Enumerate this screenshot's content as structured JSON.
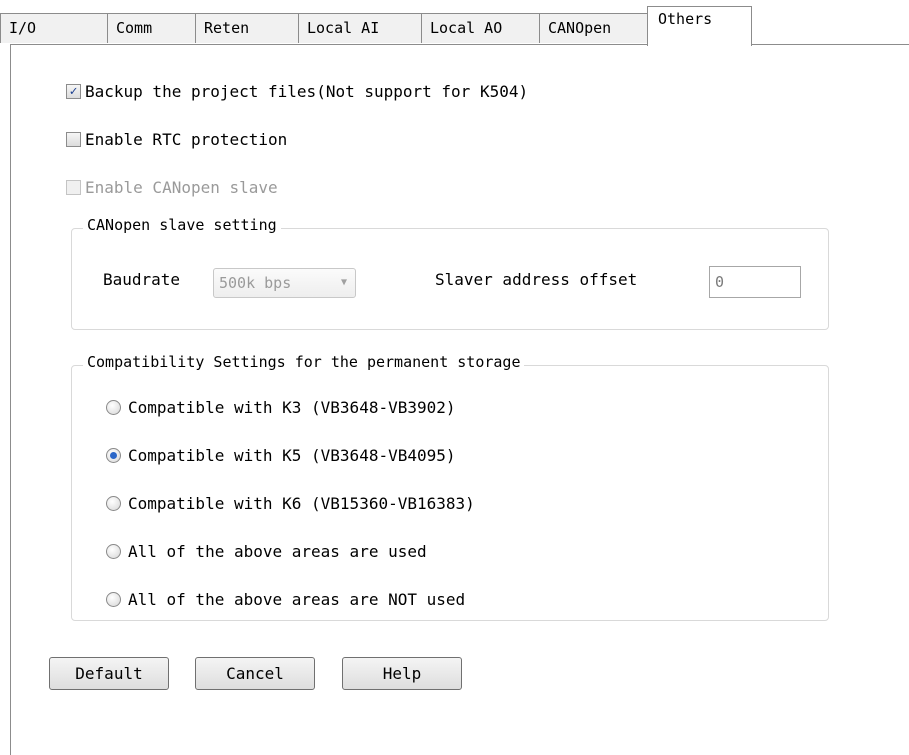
{
  "tabs": [
    {
      "label": "I/O",
      "active": false
    },
    {
      "label": "Comm",
      "active": false
    },
    {
      "label": "Reten",
      "active": false
    },
    {
      "label": "Local AI",
      "active": false
    },
    {
      "label": "Local AO",
      "active": false
    },
    {
      "label": "CANOpen",
      "active": false
    },
    {
      "label": "Others",
      "active": true
    }
  ],
  "options": {
    "backup": {
      "label": "Backup the project files(Not support for K504)",
      "checked": true,
      "enabled": true
    },
    "rtc": {
      "label": "Enable RTC protection",
      "checked": false,
      "enabled": true
    },
    "canopen_slave": {
      "label": "Enable CANopen slave",
      "checked": false,
      "enabled": false
    }
  },
  "canopen_group": {
    "title": "CANopen slave setting",
    "baudrate_label": "Baudrate",
    "baudrate_value": "500k bps",
    "offset_label": "Slaver address offset",
    "offset_value": "0"
  },
  "compat_group": {
    "title": "Compatibility Settings for the permanent storage",
    "options": [
      {
        "label": "Compatible with K3  (VB3648-VB3902)",
        "selected": false
      },
      {
        "label": "Compatible with K5  (VB3648-VB4095)",
        "selected": true
      },
      {
        "label": "Compatible with K6  (VB15360-VB16383)",
        "selected": false
      },
      {
        "label": "All of the above areas are used",
        "selected": false
      },
      {
        "label": "All of the above areas are NOT used",
        "selected": false
      }
    ]
  },
  "buttons": {
    "default": "Default",
    "cancel": "Cancel",
    "help": "Help"
  },
  "colors": {
    "check_mark": "#1c3f8f",
    "radio_selected": "#2a66c8",
    "disabled_text": "#9a9a9a"
  }
}
